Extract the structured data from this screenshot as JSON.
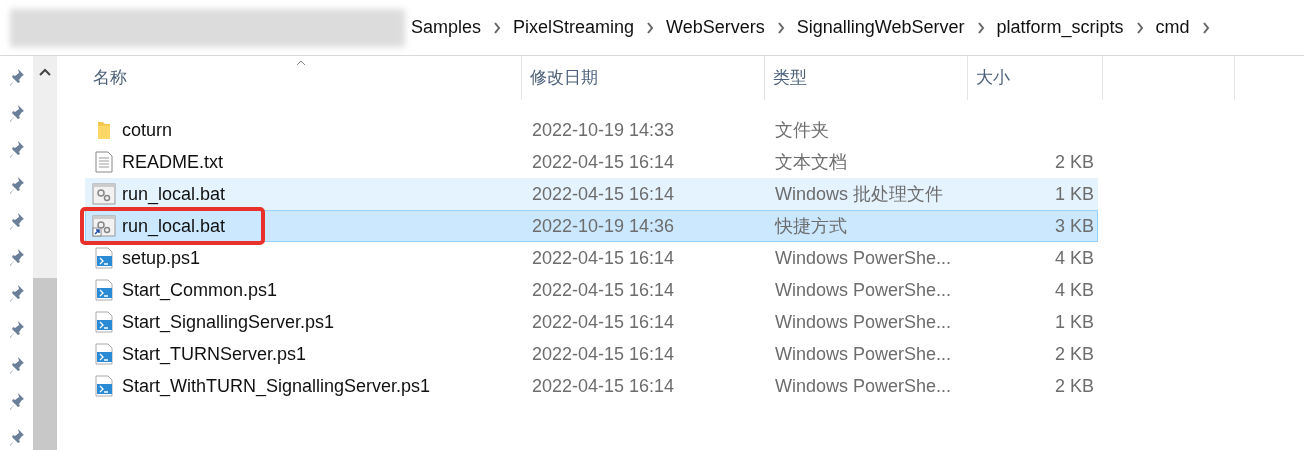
{
  "breadcrumb": [
    "Samples",
    "PixelStreaming",
    "WebServers",
    "SignallingWebServer",
    "platform_scripts",
    "cmd"
  ],
  "columns": [
    "名称",
    "修改日期",
    "类型",
    "大小"
  ],
  "rows": [
    {
      "kind": "folder",
      "name": "coturn",
      "date": "2022-10-19 14:33",
      "type": "文件夹",
      "size": "",
      "selected": false,
      "hovered": false,
      "highlighted": false
    },
    {
      "kind": "text",
      "name": "README.txt",
      "date": "2022-04-15 16:14",
      "type": "文本文档",
      "size": "2 KB",
      "selected": false,
      "hovered": false,
      "highlighted": false
    },
    {
      "kind": "batch",
      "name": "run_local.bat",
      "date": "2022-04-15 16:14",
      "type": "Windows 批处理文件",
      "size": "1 KB",
      "selected": false,
      "hovered": true,
      "highlighted": false
    },
    {
      "kind": "shortcut",
      "name": "run_local.bat",
      "date": "2022-10-19 14:36",
      "type": "快捷方式",
      "size": "3 KB",
      "selected": true,
      "hovered": false,
      "highlighted": true
    },
    {
      "kind": "powershell",
      "name": "setup.ps1",
      "date": "2022-04-15 16:14",
      "type": "Windows PowerShe...",
      "size": "4 KB",
      "selected": false,
      "hovered": false,
      "highlighted": false
    },
    {
      "kind": "powershell",
      "name": "Start_Common.ps1",
      "date": "2022-04-15 16:14",
      "type": "Windows PowerShe...",
      "size": "4 KB",
      "selected": false,
      "hovered": false,
      "highlighted": false
    },
    {
      "kind": "powershell",
      "name": "Start_SignallingServer.ps1",
      "date": "2022-04-15 16:14",
      "type": "Windows PowerShe...",
      "size": "1 KB",
      "selected": false,
      "hovered": false,
      "highlighted": false
    },
    {
      "kind": "powershell",
      "name": "Start_TURNServer.ps1",
      "date": "2022-04-15 16:14",
      "type": "Windows PowerShe...",
      "size": "2 KB",
      "selected": false,
      "hovered": false,
      "highlighted": false
    },
    {
      "kind": "powershell",
      "name": "Start_WithTURN_SignallingServer.ps1",
      "date": "2022-04-15 16:14",
      "type": "Windows PowerShe...",
      "size": "2 KB",
      "selected": false,
      "hovered": false,
      "highlighted": false
    }
  ]
}
